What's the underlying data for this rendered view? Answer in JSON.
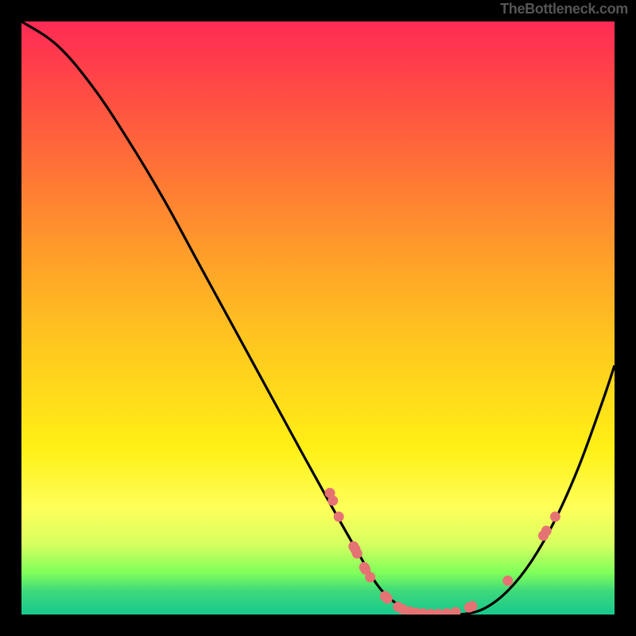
{
  "attribution": "TheBottleneck.com",
  "colors": {
    "page_bg": "#000000",
    "curve": "#000000",
    "markers": "#e57373",
    "gradient_top": "#ff2a55",
    "gradient_bottom": "#17c98e"
  },
  "chart_data": {
    "type": "line",
    "title": "",
    "xlabel": "",
    "ylabel": "",
    "xlim": [
      0,
      100
    ],
    "ylim": [
      0,
      100
    ],
    "grid": false,
    "legend": false,
    "series": [
      {
        "name": "bottleneck-curve",
        "x": [
          0,
          6,
          12,
          18,
          24,
          30,
          36,
          42,
          48,
          53,
          57,
          60,
          63,
          66,
          70,
          74,
          78,
          82,
          86,
          90,
          94,
          98,
          100
        ],
        "values": [
          100,
          96,
          89,
          80,
          70,
          59,
          48,
          37,
          26,
          17,
          10,
          5,
          2,
          0.5,
          0,
          0,
          1,
          4,
          9,
          16,
          25,
          36,
          42
        ]
      }
    ],
    "markers": [
      {
        "x": 52.0,
        "y": 20.5
      },
      {
        "x": 52.5,
        "y": 19.2
      },
      {
        "x": 53.5,
        "y": 16.5
      },
      {
        "x": 56.0,
        "y": 11.5
      },
      {
        "x": 56.3,
        "y": 11.0
      },
      {
        "x": 56.6,
        "y": 10.3
      },
      {
        "x": 57.8,
        "y": 8.0
      },
      {
        "x": 58.0,
        "y": 7.6
      },
      {
        "x": 58.8,
        "y": 6.3
      },
      {
        "x": 61.3,
        "y": 3.1
      },
      {
        "x": 61.7,
        "y": 2.7
      },
      {
        "x": 63.5,
        "y": 1.3
      },
      {
        "x": 64.3,
        "y": 0.9
      },
      {
        "x": 65.5,
        "y": 0.5
      },
      {
        "x": 66.5,
        "y": 0.3
      },
      {
        "x": 67.7,
        "y": 0.2
      },
      {
        "x": 69.0,
        "y": 0.1
      },
      {
        "x": 70.3,
        "y": 0.1
      },
      {
        "x": 71.7,
        "y": 0.2
      },
      {
        "x": 73.2,
        "y": 0.4
      },
      {
        "x": 75.5,
        "y": 1.2
      },
      {
        "x": 76.0,
        "y": 1.4
      },
      {
        "x": 82.0,
        "y": 5.7
      },
      {
        "x": 88.0,
        "y": 13.3
      },
      {
        "x": 88.5,
        "y": 14.1
      },
      {
        "x": 90.0,
        "y": 16.5
      }
    ]
  }
}
